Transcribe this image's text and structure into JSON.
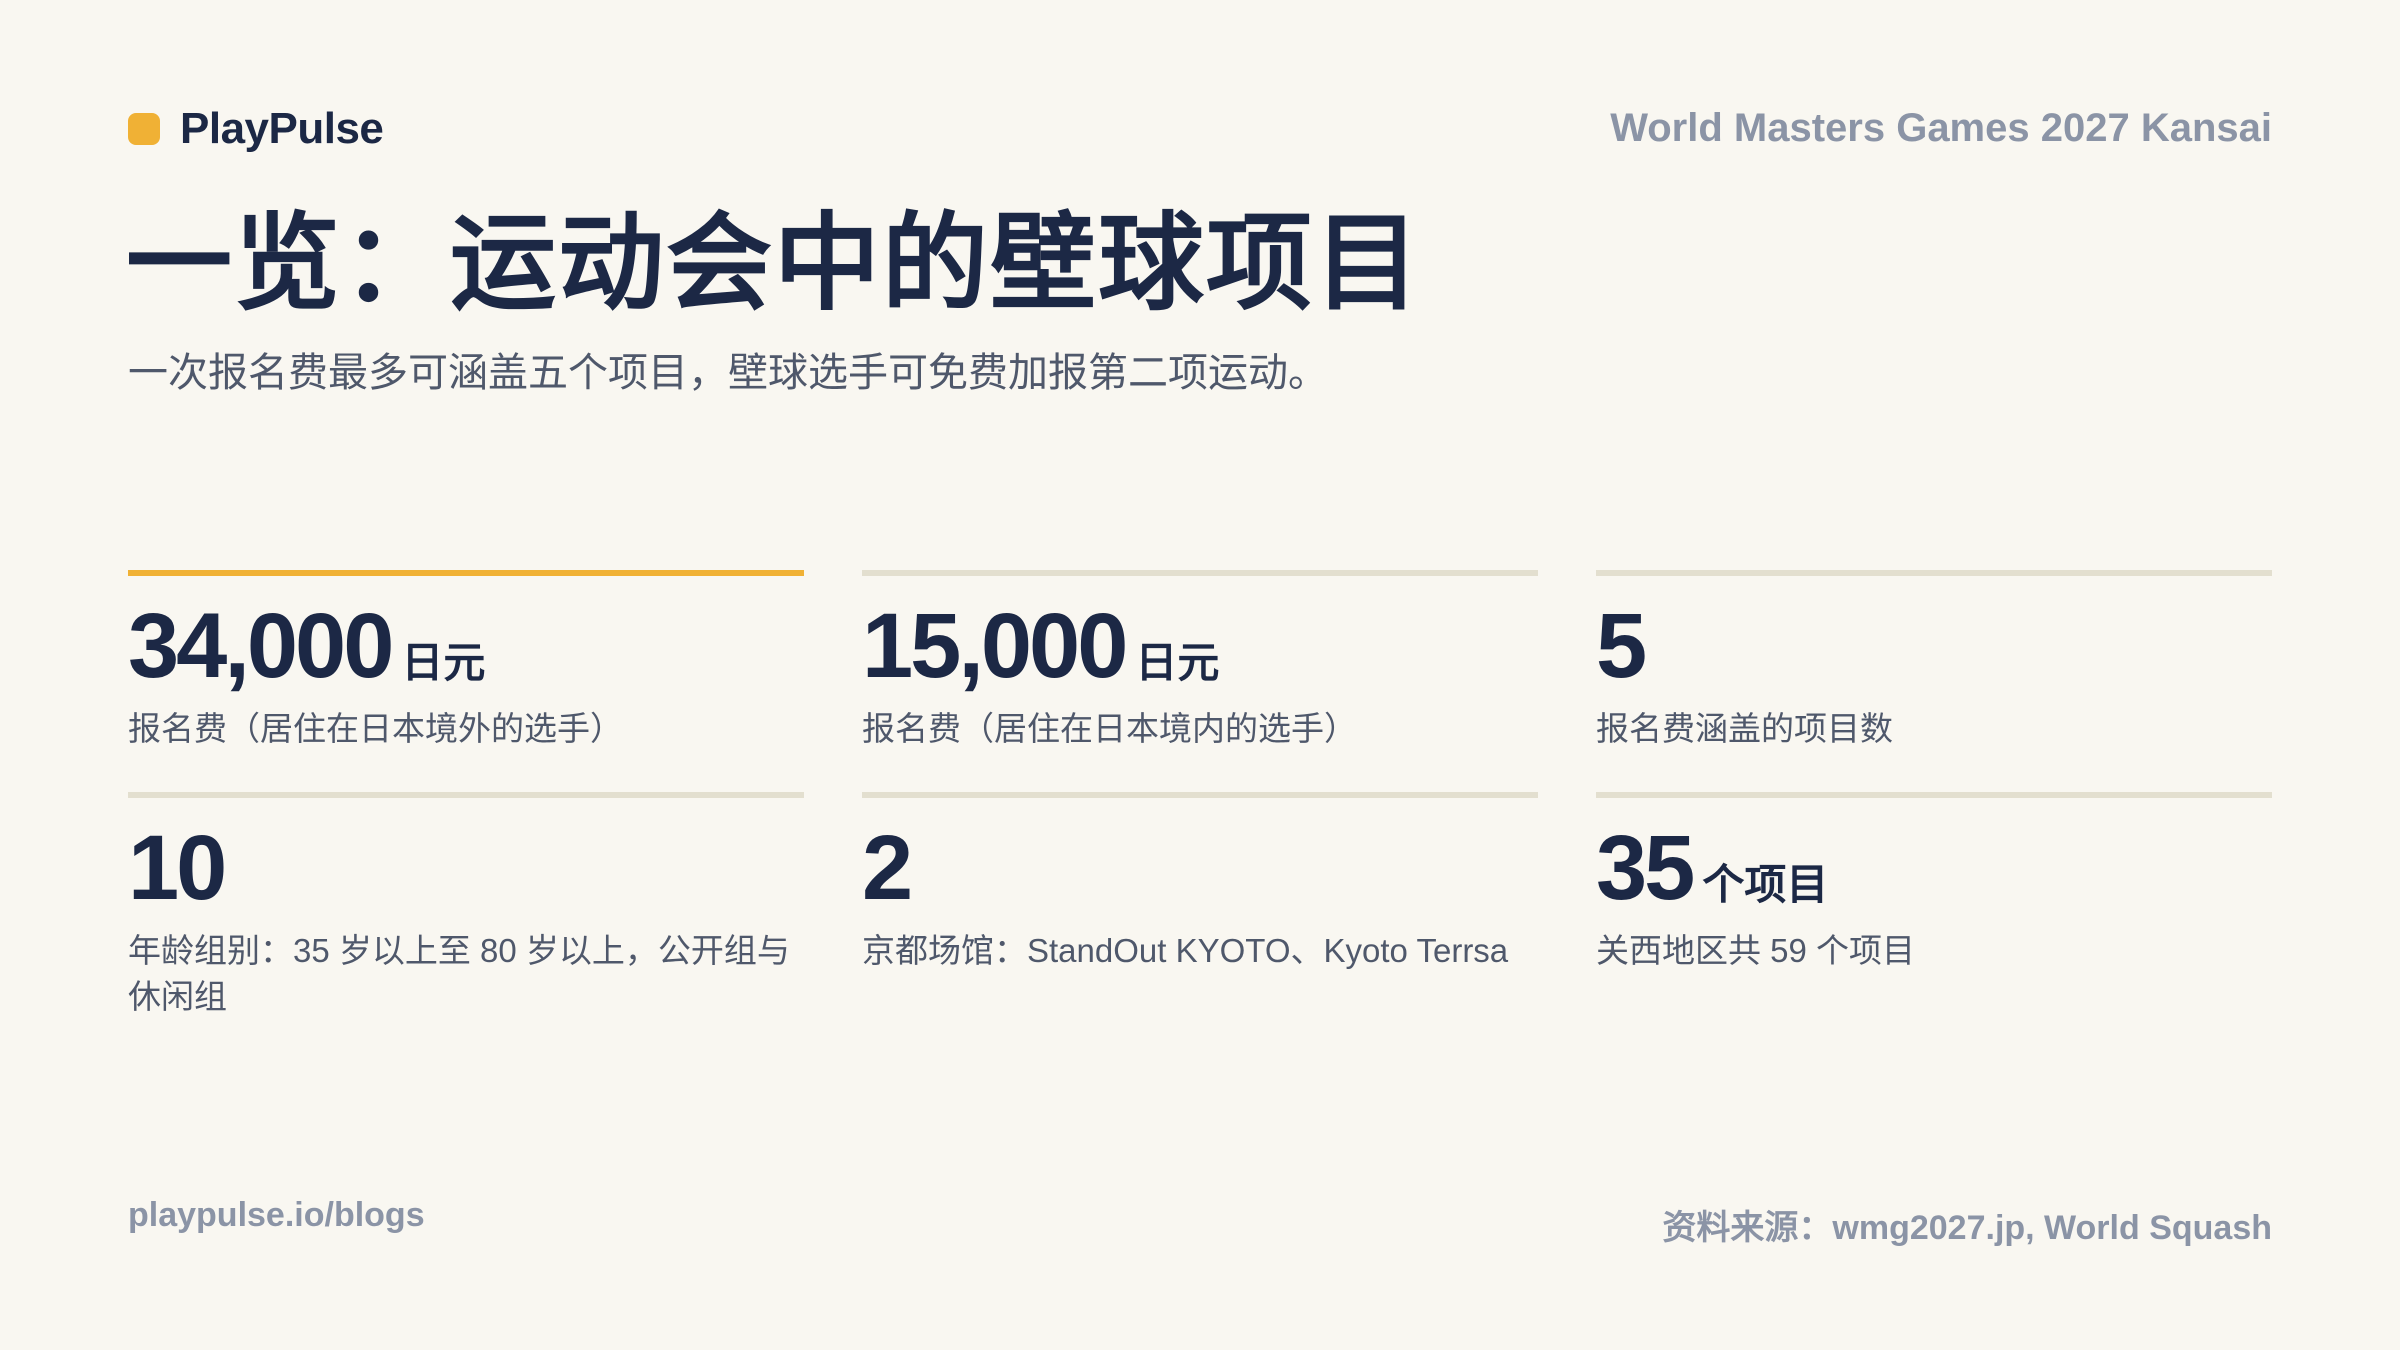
{
  "brand": {
    "name": "PlayPulse",
    "dot_color": "#f0b135"
  },
  "event": "World Masters Games 2027 Kansai",
  "title": "一览：运动会中的壁球项目",
  "subtitle": "一次报名费最多可涵盖五个项目，壁球选手可免费加报第二项运动。",
  "stats": [
    {
      "value": "34,000",
      "unit": "日元",
      "label": "报名费（居住在日本境外的选手）",
      "highlight": true
    },
    {
      "value": "15,000",
      "unit": "日元",
      "label": "报名费（居住在日本境内的选手）",
      "highlight": false
    },
    {
      "value": "5",
      "unit": "",
      "label": "报名费涵盖的项目数",
      "highlight": false
    },
    {
      "value": "10",
      "unit": "",
      "label": "年龄组别：35 岁以上至 80 岁以上，公开组与休闲组",
      "highlight": false
    },
    {
      "value": "2",
      "unit": "",
      "label": "京都场馆：StandOut KYOTO、Kyoto Terrsa",
      "highlight": false
    },
    {
      "value": "35",
      "unit": "个项目",
      "label": "关西地区共 59 个项目",
      "highlight": false
    }
  ],
  "footer": {
    "url": "playpulse.io/blogs",
    "source": "资料来源：wmg2027.jp, World Squash"
  },
  "colors": {
    "background": "#f9f7f1",
    "navy": "#1c2845",
    "accent": "#f0b135",
    "divider": "#e3dfcf",
    "muted": "#8b94a6"
  }
}
